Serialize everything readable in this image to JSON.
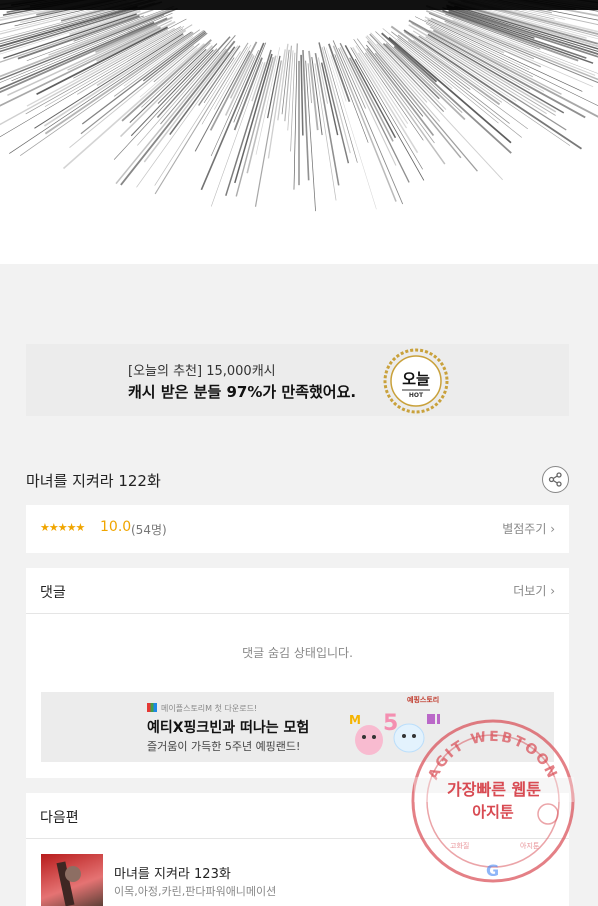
{
  "banner": {
    "line1": "[오늘의 추천] 15,000캐시",
    "line2": "캐시 받은 분들 97%가 만족했어요.",
    "badge_label": "오늘",
    "badge_sub": "HOT"
  },
  "episode": {
    "title": "마녀를 지켜라 122화"
  },
  "rating": {
    "stars": "★★★★★",
    "score": "10.0",
    "votes": "(54명)",
    "rate_link": "별점주기 ›"
  },
  "comments": {
    "heading": "댓글",
    "more_link": "더보기 ›",
    "hidden_message": "댓글 숨김 상태입니다.",
    "ad": {
      "brand": "메이플스토리M 첫 다운로드!",
      "title": "예티X핑크빈과 떠나는 모험",
      "subtitle": "즐거움이 가득한 5주년 예핑랜드!",
      "tag": "예핑스토리"
    }
  },
  "next": {
    "heading": "다음편",
    "episode_title": "마녀를 지켜라 123화",
    "credits": "이목,아정,카린,판다파워애니메이션"
  },
  "watermark": {
    "arc_text": "AGIT WEBTOON",
    "line1": "가장빠른 웹툰",
    "line2": "아지툰",
    "bottom_left": "고화질",
    "bottom_right": "아지툰"
  },
  "colors": {
    "accent": "#f0a500",
    "watermark": "#d84a52",
    "background": "#f2f2f2"
  }
}
